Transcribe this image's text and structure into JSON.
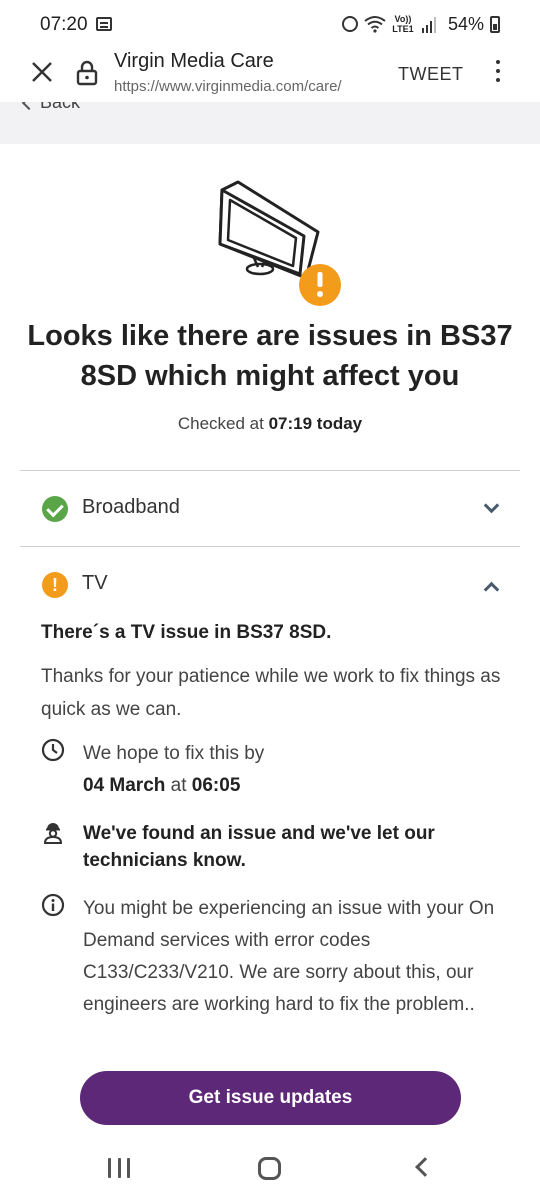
{
  "status_bar": {
    "time": "07:20",
    "network_label": "Vo)) LTE1",
    "battery": "54%"
  },
  "browser": {
    "title": "Virgin Media Care",
    "url": "https://www.virginmedia.com/care/",
    "action": "TWEET"
  },
  "page": {
    "back_label": "Back",
    "headline": "Looks like there are issues in BS37 8SD which might affect you",
    "checked_prefix": "Checked at",
    "checked_time": "07:19 today"
  },
  "services": [
    {
      "label": "Broadband",
      "status": "ok",
      "expanded": false
    },
    {
      "label": "TV",
      "status": "warning",
      "expanded": true
    }
  ],
  "tv_issue": {
    "title": "There´s a TV issue in BS37 8SD.",
    "description": "Thanks for your patience while we work to fix things as quick as we can.",
    "fix_prefix": "We hope to fix this by",
    "fix_date": "04 March",
    "fix_at": "at",
    "fix_time": "06:05",
    "technician_note": "We've found an issue and we've let our technicians know.",
    "info_note": "You might be experiencing an issue with your On Demand services with error codes C133/C233/V210. We are sorry about this, our engineers are working hard to fix the problem.."
  },
  "cta_label": "Get issue updates",
  "colors": {
    "brand_purple": "#5e2878",
    "ok_green": "#5aa547",
    "warning_orange": "#f39b1a"
  }
}
